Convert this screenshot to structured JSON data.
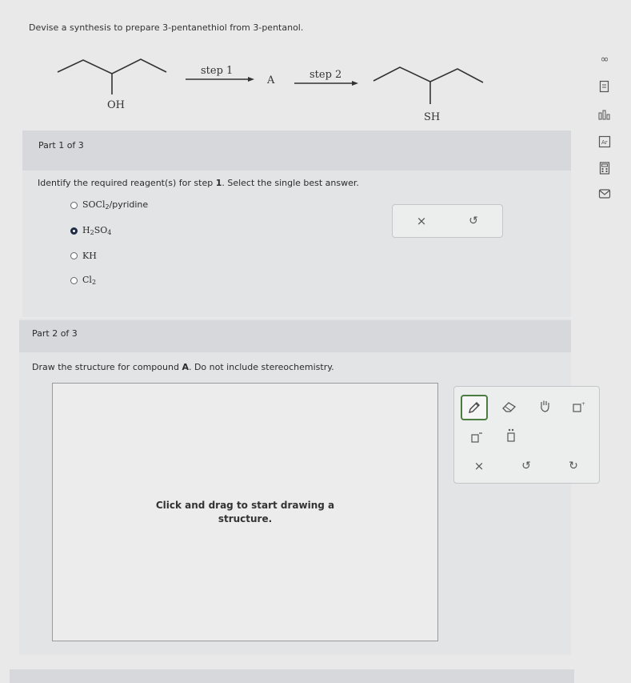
{
  "question": {
    "text": "Devise a synthesis to prepare 3-pentanethiol from 3-pentanol."
  },
  "scheme": {
    "reactant_group": "OH",
    "step1_label": "step 1",
    "intermediate_label": "A",
    "step2_label": "step 2",
    "product_group": "SH"
  },
  "part1": {
    "header": "Part 1 of 3",
    "prompt_prefix": "Identify the required reagent(s) for step ",
    "prompt_step": "1",
    "prompt_suffix": ". Select the single best answer.",
    "options": [
      {
        "main": "SOCl",
        "sub": "2",
        "tail": "/pyridine",
        "selected": false
      },
      {
        "main": "H",
        "sub": "2",
        "tail": "SO",
        "sub2": "4",
        "selected": true
      },
      {
        "main": "KH",
        "selected": false
      },
      {
        "main": "Cl",
        "sub": "2",
        "selected": false
      }
    ],
    "toolbar": {
      "clear": "×",
      "undo": "↺"
    }
  },
  "part2": {
    "header": "Part 2 of 3",
    "prompt_prefix": "Draw the structure for compound ",
    "prompt_bold": "A",
    "prompt_suffix": ". Do not include stereochemistry.",
    "canvas_hint_line1": "Click and drag to start drawing a",
    "canvas_hint_line2": "structure.",
    "toolbar": {
      "clear": "×",
      "undo": "↺",
      "redo": "↻"
    }
  },
  "sidebar": {
    "icons": [
      "infinity-icon",
      "notes-icon",
      "data-icon",
      "periodic-table-icon",
      "calculator-icon",
      "mail-icon"
    ],
    "infinity_glyph": "∞"
  },
  "colors": {
    "selected_radio": "#1f2a44",
    "active_tool": "#4a7d3f"
  }
}
